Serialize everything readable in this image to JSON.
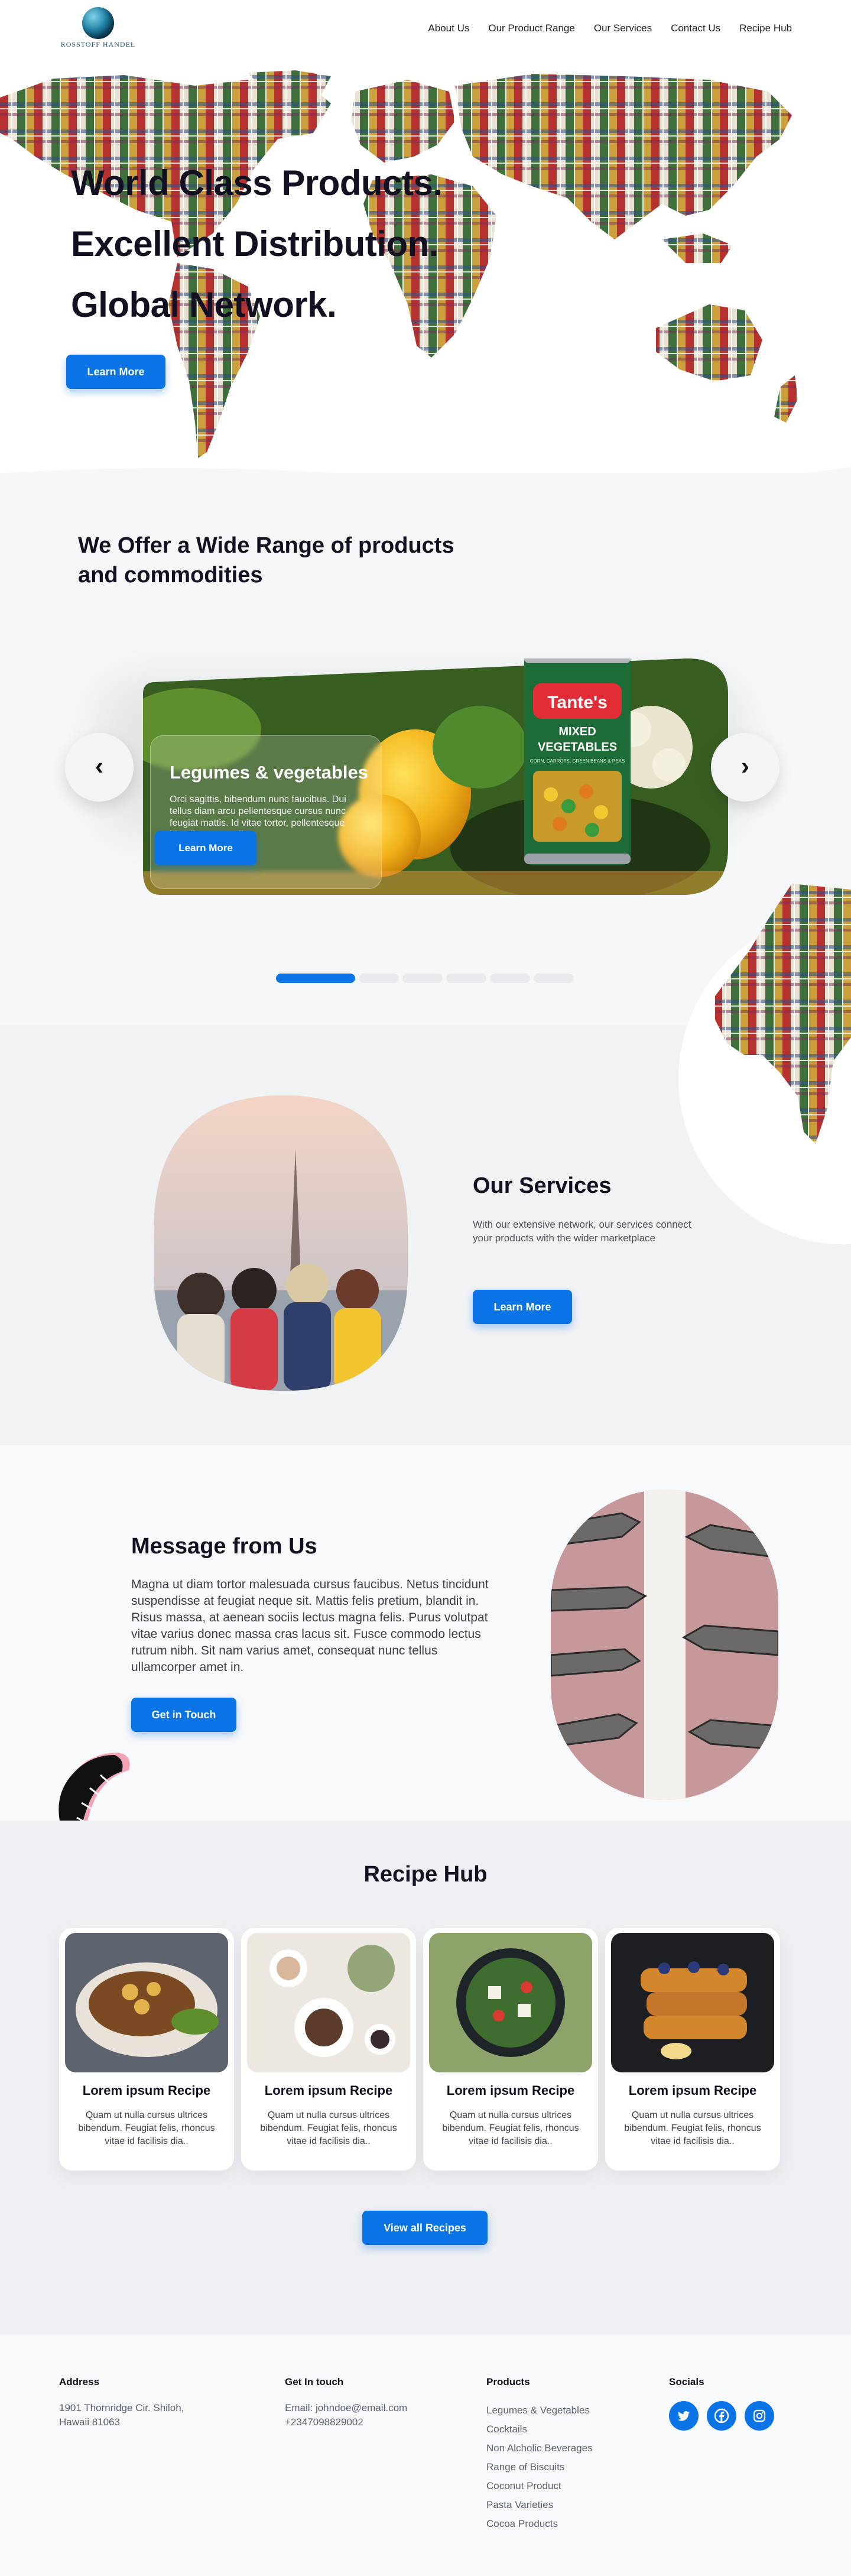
{
  "brand": {
    "logo_text": "ROSSTOFF HANDEL"
  },
  "nav": {
    "items": [
      {
        "label": "About Us"
      },
      {
        "label": "Our Product Range"
      },
      {
        "label": "Our Services"
      },
      {
        "label": "Contact Us"
      },
      {
        "label": "Recipe Hub"
      }
    ]
  },
  "hero": {
    "lines": [
      "World Class Products.",
      "Excellent Distribution.",
      "Global Network."
    ],
    "button": "Learn More"
  },
  "products": {
    "title": "We Offer a Wide Range of products and commodities",
    "slide": {
      "title": "Legumes & vegetables",
      "text": "Orci sagittis, bibendum nunc faucibus. Dui tellus diam arcu pellentesque cursus nunc feugiat mattis. Id vitae tortor, pellentesque blandit cursus odio.",
      "button": "Learn More",
      "can_brand": "Tante's",
      "can_label_1": "MIXED",
      "can_label_2": "VEGETABLES",
      "can_sub": "CORN, CARROTS, GREEN BEANS & PEAS"
    },
    "slider": {
      "total": 6,
      "active": 1
    }
  },
  "services": {
    "title": "Our Services",
    "text": "With our extensive network, our services connect your products with the wider marketplace",
    "button": "Learn More"
  },
  "message": {
    "title": "Message from Us",
    "text": "Magna ut diam tortor malesuada cursus faucibus. Netus tincidunt suspendisse at feugiat neque sit. Mattis felis pretium, blandit in. Risus massa, at aenean sociis lectus magna felis. Purus volutpat vitae varius donec massa cras lacus sit. Fusce commodo lectus rutrum nibh. Sit nam varius amet, consequat nunc tellus ullamcorper amet in.",
    "button": "Get in Touch"
  },
  "recipes": {
    "title": "Recipe Hub",
    "cards": [
      {
        "title": "Lorem ipsum Recipe",
        "text": "Quam ut nulla cursus ultrices bibendum. Feugiat felis, rhoncus vitae id facilisis dia.."
      },
      {
        "title": "Lorem ipsum Recipe",
        "text": "Quam ut nulla cursus ultrices bibendum. Feugiat felis, rhoncus vitae id facilisis dia.."
      },
      {
        "title": "Lorem ipsum Recipe",
        "text": "Quam ut nulla cursus ultrices bibendum. Feugiat felis, rhoncus vitae id facilisis dia.."
      },
      {
        "title": "Lorem ipsum Recipe",
        "text": "Quam ut nulla cursus ultrices bibendum. Feugiat felis, rhoncus vitae id facilisis dia.."
      }
    ],
    "button": "View all Recipes"
  },
  "footer": {
    "address": {
      "heading": "Address",
      "line1": "1901 Thornridge Cir. Shiloh,",
      "line2": "Hawaii 81063"
    },
    "contact": {
      "heading": "Get  In touch",
      "email": "Email: johndoe@email.com",
      "phone": "+2347098829002"
    },
    "products": {
      "heading": "Products",
      "items": [
        "Legumes & Vegetables",
        "Cocktails",
        "Non Alcholic Beverages",
        "Range of Biscuits",
        "Coconut Product",
        "Pasta Varieties",
        "Cocoa Products"
      ]
    },
    "socials": {
      "heading": "Socials",
      "icons": [
        "twitter-icon",
        "facebook-icon",
        "instagram-icon"
      ]
    }
  },
  "colors": {
    "accent": "#0a74e6",
    "heading": "#121021",
    "body_text": "#3c3f49",
    "section_bg": "#f1f2f4"
  }
}
